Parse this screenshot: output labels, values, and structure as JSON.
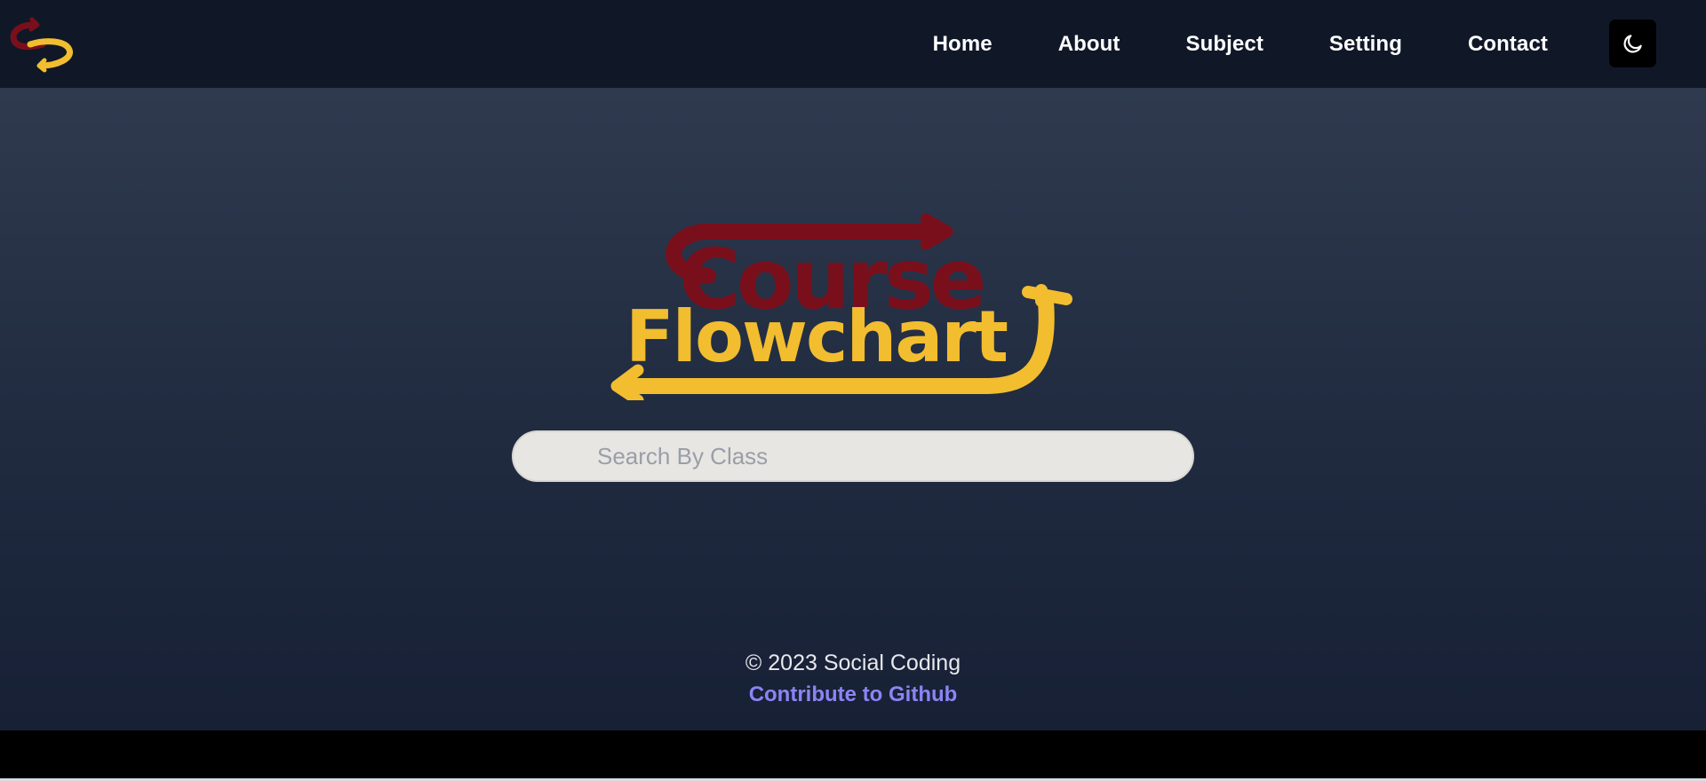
{
  "header": {
    "logo_icon": "social-coding-swirl-logo",
    "nav": [
      {
        "label": "Home"
      },
      {
        "label": "About"
      },
      {
        "label": "Subject"
      },
      {
        "label": "Setting"
      },
      {
        "label": "Contact"
      }
    ],
    "theme_toggle_icon": "moon-icon"
  },
  "hero": {
    "logo_text_top": "Course",
    "logo_text_bottom": "Flowchart",
    "logo_colors": {
      "top": "#7a0f1c",
      "bottom": "#f2bd2f"
    }
  },
  "search": {
    "placeholder": "Search By Class",
    "value": ""
  },
  "footer": {
    "copyright": "© 2023 Social Coding",
    "github_link": "Contribute to Github"
  },
  "colors": {
    "navbar_bg": "#101828",
    "link_accent": "#8b84f5",
    "brand_red": "#7a0f1c",
    "brand_yellow": "#f2bd2f"
  }
}
